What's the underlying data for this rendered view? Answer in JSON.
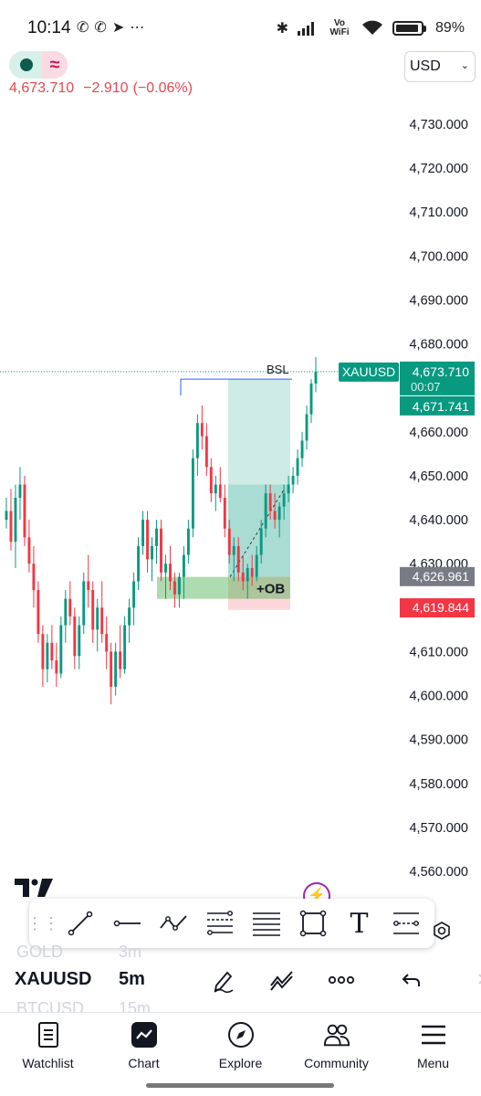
{
  "status_bar": {
    "time": "10:14",
    "left_icons": [
      "whatsapp-business-icon",
      "whatsapp-icon",
      "telegram-icon",
      "more-dots-icon"
    ],
    "network": "Vo WiFi",
    "battery": "89%"
  },
  "header": {
    "market_status_icons": [
      "market-open-dot-icon",
      "extended-hours-wave-icon"
    ],
    "wave_glyph": "≈",
    "price": "4,673.710",
    "change": "−2.910",
    "change_pct": "(−0.06%)",
    "currency": "USD",
    "price_color": "#e5484d"
  },
  "chart_data": {
    "type": "candlestick",
    "symbol": "XAUUSD",
    "y_range": [
      4552.5,
      4736
    ],
    "y_ticks": [
      "4,730.000",
      "4,720.000",
      "4,710.000",
      "4,700.000",
      "4,690.000",
      "4,680.000",
      "4,670.000",
      "4,660.000",
      "4,650.000",
      "4,640.000",
      "4,630.000",
      "4,620.000",
      "4,610.000",
      "4,600.000",
      "4,590.000",
      "4,580.000",
      "4,570.000",
      "4,560.000"
    ],
    "y_tick_values": [
      4730,
      4720,
      4710,
      4700,
      4690,
      4680,
      4670,
      4660,
      4650,
      4640,
      4630,
      4620,
      4610,
      4600,
      4590,
      4580,
      4570,
      4560
    ],
    "up_color": "#089981",
    "down_color": "#f23645",
    "candles": [
      [
        4640,
        4645,
        4638,
        4642
      ],
      [
        4642,
        4647,
        4633,
        4635
      ],
      [
        4635,
        4648,
        4629,
        4645
      ],
      [
        4645,
        4652,
        4640,
        4648
      ],
      [
        4648,
        4650,
        4634,
        4636
      ],
      [
        4636,
        4640,
        4628,
        4630
      ],
      [
        4630,
        4634,
        4620,
        4624
      ],
      [
        4624,
        4626,
        4612,
        4614
      ],
      [
        4614,
        4616,
        4602,
        4606
      ],
      [
        4606,
        4614,
        4603,
        4612
      ],
      [
        4612,
        4616,
        4606,
        4608
      ],
      [
        4608,
        4612,
        4602,
        4605
      ],
      [
        4605,
        4618,
        4604,
        4616
      ],
      [
        4616,
        4624,
        4612,
        4622
      ],
      [
        4622,
        4626,
        4616,
        4618
      ],
      [
        4618,
        4620,
        4606,
        4609
      ],
      [
        4609,
        4618,
        4606,
        4616
      ],
      [
        4616,
        4628,
        4614,
        4626
      ],
      [
        4626,
        4632,
        4620,
        4624
      ],
      [
        4624,
        4626,
        4612,
        4615
      ],
      [
        4615,
        4622,
        4610,
        4620
      ],
      [
        4620,
        4626,
        4612,
        4614
      ],
      [
        4614,
        4618,
        4606,
        4610
      ],
      [
        4610,
        4612,
        4598,
        4602
      ],
      [
        4602,
        4612,
        4600,
        4610
      ],
      [
        4610,
        4616,
        4604,
        4606
      ],
      [
        4606,
        4618,
        4605,
        4616
      ],
      [
        4616,
        4622,
        4612,
        4620
      ],
      [
        4620,
        4628,
        4616,
        4626
      ],
      [
        4626,
        4636,
        4624,
        4634
      ],
      [
        4634,
        4642,
        4632,
        4640
      ],
      [
        4640,
        4642,
        4628,
        4631
      ],
      [
        4631,
        4636,
        4626,
        4634
      ],
      [
        4634,
        4640,
        4630,
        4638
      ],
      [
        4638,
        4640,
        4626,
        4628
      ],
      [
        4628,
        4632,
        4622,
        4630
      ],
      [
        4630,
        4634,
        4624,
        4626
      ],
      [
        4626,
        4628,
        4620,
        4623
      ],
      [
        4623,
        4628,
        4620,
        4627
      ],
      [
        4627,
        4634,
        4622,
        4632
      ],
      [
        4632,
        4640,
        4630,
        4638
      ],
      [
        4638,
        4656,
        4636,
        4654
      ],
      [
        4654,
        4664,
        4650,
        4662
      ],
      [
        4662,
        4666,
        4656,
        4659
      ],
      [
        4659,
        4662,
        4650,
        4652
      ],
      [
        4652,
        4654,
        4644,
        4646
      ],
      [
        4646,
        4650,
        4642,
        4648
      ],
      [
        4648,
        4652,
        4644,
        4645
      ],
      [
        4645,
        4648,
        4636,
        4638
      ],
      [
        4638,
        4640,
        4630,
        4632
      ],
      [
        4632,
        4636,
        4626,
        4634
      ],
      [
        4634,
        4636,
        4626,
        4628
      ],
      [
        4628,
        4632,
        4624,
        4626
      ],
      [
        4626,
        4630,
        4622,
        4629
      ],
      [
        4629,
        4632,
        4625,
        4627
      ],
      [
        4627,
        4634,
        4626,
        4632
      ],
      [
        4632,
        4640,
        4630,
        4638
      ],
      [
        4638,
        4648,
        4636,
        4646
      ],
      [
        4646,
        4648,
        4640,
        4642
      ],
      [
        4642,
        4646,
        4638,
        4640
      ],
      [
        4640,
        4644,
        4636,
        4643
      ],
      [
        4643,
        4648,
        4640,
        4646
      ],
      [
        4646,
        4650,
        4644,
        4648
      ],
      [
        4648,
        4652,
        4646,
        4650
      ],
      [
        4650,
        4656,
        4648,
        4654
      ],
      [
        4654,
        4660,
        4652,
        4658
      ],
      [
        4658,
        4666,
        4656,
        4664
      ],
      [
        4664,
        4672,
        4662,
        4671
      ],
      [
        4671,
        4677,
        4669,
        4673.71
      ]
    ],
    "drawings": {
      "bsl_level": 4672,
      "bsl_label": "BSL",
      "ob_top": 4627,
      "ob_bottom": 4622,
      "ob_label": "+OB",
      "long_entry": 4627,
      "long_target": 4672,
      "long_stop": 4619.5,
      "long_mid": 4648
    },
    "labels": {
      "symbol_tag": "XAUUSD",
      "last_price": "4,673.710",
      "countdown": "00:07",
      "price_tag_2": "4,671.741",
      "entry_tag": "4,626.961",
      "stop_tag": "4,619.844"
    }
  },
  "toolbar": {
    "tools": [
      "trend-line-icon",
      "horizontal-ray-icon",
      "path-icon",
      "fib-retracement-icon",
      "parallel-channel-icon",
      "rectangle-icon",
      "text-icon",
      "regression-icon"
    ],
    "text_tool_label": "T"
  },
  "symbol_bar": {
    "prev_symbol": "GOLD",
    "prev_interval": "3m",
    "symbol": "XAUUSD",
    "interval": "5m",
    "next_symbol": "BTCUSD",
    "next_interval": "15m"
  },
  "nav": [
    {
      "label": "Watchlist",
      "icon": "watchlist-icon"
    },
    {
      "label": "Chart",
      "icon": "chart-icon"
    },
    {
      "label": "Explore",
      "icon": "compass-icon"
    },
    {
      "label": "Community",
      "icon": "community-icon"
    },
    {
      "label": "Menu",
      "icon": "menu-icon"
    }
  ]
}
